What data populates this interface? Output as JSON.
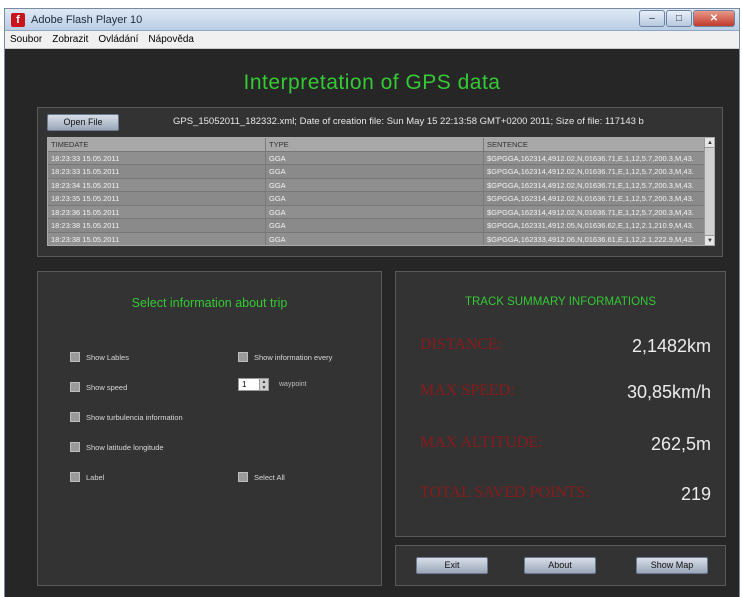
{
  "window": {
    "title": "Adobe Flash Player 10",
    "controls": [
      "–",
      "□",
      "✕"
    ]
  },
  "menu": [
    "Soubor",
    "Zobrazit",
    "Ovládání",
    "Nápověda"
  ],
  "title": "Interpretation of GPS data",
  "file": {
    "open_label": "Open File",
    "info": "GPS_15052011_182332.xml; Date of creation file: Sun May 15 22:13:58 GMT+0200 2011; Size of file: 117143 b"
  },
  "table": {
    "columns": [
      "TIMEDATE",
      "TYPE",
      "SENTENCE"
    ],
    "rows": [
      [
        "18:23:33 15.05.2011",
        "GGA",
        "$GPGGA,162314,4912.02,N,01636.71,E,1,12,5.7,200.3,M,43."
      ],
      [
        "18:23:33 15.05.2011",
        "GGA",
        "$GPGGA,162314,4912.02,N,01636.71,E,1,12,5.7,200.3,M,43."
      ],
      [
        "18:23:34 15.05.2011",
        "GGA",
        "$GPGGA,162314,4912.02,N,01636.71,E,1,12,5.7,200.3,M,43."
      ],
      [
        "18:23:35 15.05.2011",
        "GGA",
        "$GPGGA,162314,4912.02,N,01636.71,E,1,12,5.7,200.3,M,43."
      ],
      [
        "18:23:36 15.05.2011",
        "GGA",
        "$GPGGA,162314,4912.02,N,01636.71,E,1,12,5.7,200.3,M,43."
      ],
      [
        "18:23:38 15.05.2011",
        "GGA",
        "$GPGGA,162331,4912.05,N,01636.62,E,1,12,2.1,210.9,M,43."
      ],
      [
        "18:23:38 15.05.2011",
        "GGA",
        "$GPGGA,162333,4912.06,N,01636.61,E,1,12,2.1,222.9,M,43."
      ]
    ]
  },
  "trip": {
    "heading": "Select information about trip",
    "show_lables": "Show Lables",
    "show_information_every": "Show information every",
    "show_speed": "Show speed",
    "waypoint_value": "1",
    "waypoint": "waypoint",
    "show_turbulencia": "Show turbulencia information",
    "show_latlong": "Show latitude longitude",
    "label": "Label",
    "select_all": "Select All"
  },
  "summary": {
    "heading": "TRACK SUMMARY INFORMATIONS",
    "distance_label": "DISTANCE:",
    "distance_value": "2,1482km",
    "max_speed_label": "MAX SPEED:",
    "max_speed_value": "30,85km/h",
    "max_altitude_label": "MAX ALTITUDE:",
    "max_altitude_value": "262,5m",
    "total_points_label": "TOTAL SAVED POINTS:",
    "total_points_value": "219"
  },
  "buttons": {
    "exit": "Exit",
    "about": "About",
    "show_map": "Show Map"
  },
  "colors": {
    "accent_green": "#35c935",
    "stat_red": "#8a1a1a",
    "background": "#262626"
  }
}
